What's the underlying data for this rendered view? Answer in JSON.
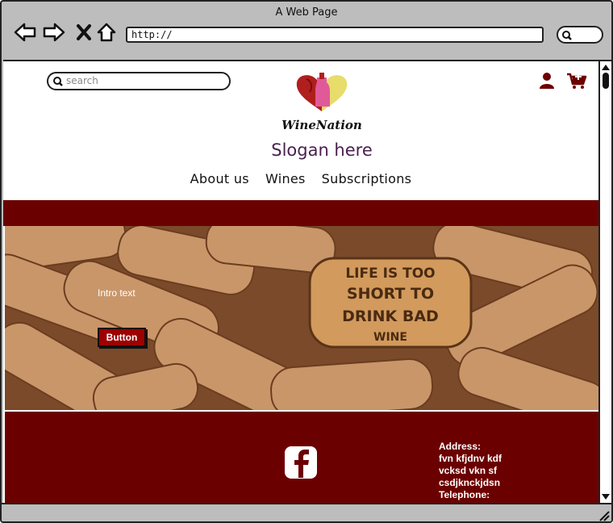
{
  "window": {
    "title": "A Web Page",
    "url": "http://"
  },
  "site": {
    "search_placeholder": "search",
    "brand": "WineNation",
    "slogan": "Slogan here",
    "nav": [
      "About us",
      "Wines",
      "Subscriptions"
    ],
    "hero": {
      "intro": "Intro text",
      "button": "Button",
      "cork_text": [
        "LIFE IS TOO",
        "SHORT TO",
        "DRINK BAD",
        "WINE"
      ]
    },
    "footer": {
      "address_lines": [
        "Address:",
        "fvn kfjdnv kdf",
        "vcksd vkn sf",
        "csdjknckjdsn",
        "Telephone:"
      ]
    }
  },
  "colors": {
    "brand_dark_red": "#6b0000",
    "button_red": "#9c0000",
    "slogan_purple": "#4a1f4f"
  }
}
